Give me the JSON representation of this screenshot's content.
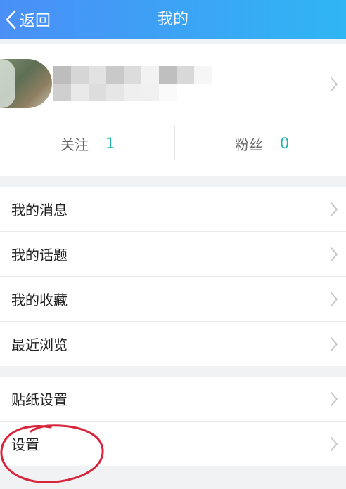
{
  "nav": {
    "back_label": "返回",
    "title": "我的",
    "gradient": [
      "#4a8ff6",
      "#2fb6f4"
    ]
  },
  "profile": {
    "stats": [
      {
        "label": "关注",
        "value": "1"
      },
      {
        "label": "粉丝",
        "value": "0"
      }
    ],
    "accent_color": "#1fb3b0"
  },
  "menu_group_1": [
    {
      "label": "我的消息"
    },
    {
      "label": "我的话题"
    },
    {
      "label": "我的收藏"
    },
    {
      "label": "最近浏览"
    }
  ],
  "menu_group_2": [
    {
      "label": "贴纸设置"
    },
    {
      "label": "设置"
    }
  ],
  "annotation_color": "#d6243a"
}
